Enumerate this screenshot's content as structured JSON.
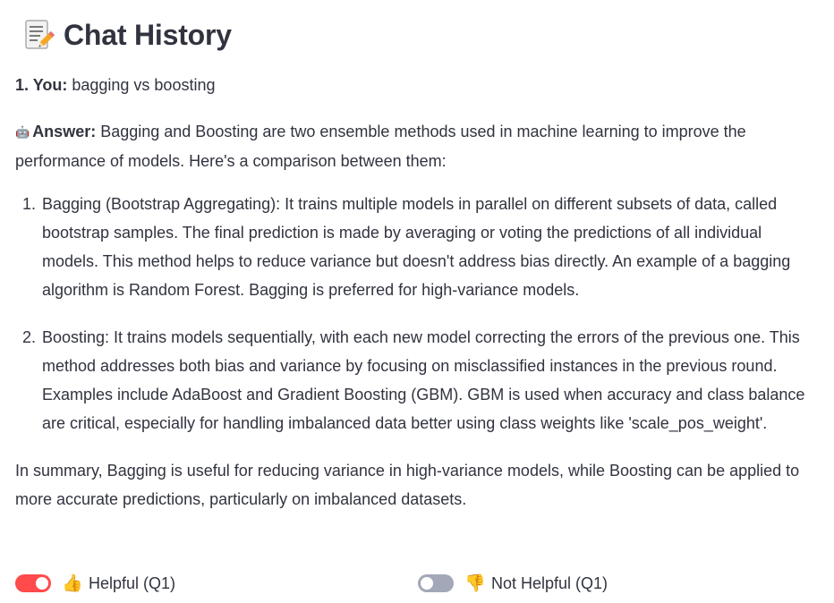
{
  "header": {
    "icon": "memo-icon",
    "title": "Chat History"
  },
  "question": {
    "label": "1. You:",
    "text": "bagging vs boosting"
  },
  "answer": {
    "emoji": "🤖",
    "label": "Answer:",
    "intro": "Bagging and Boosting are two ensemble methods used in machine learning to improve the performance of models. Here's a comparison between them:",
    "points": [
      "Bagging (Bootstrap Aggregating): It trains multiple models in parallel on different subsets of data, called bootstrap samples. The final prediction is made by averaging or voting the predictions of all individual models. This method helps to reduce variance but doesn't address bias directly. An example of a bagging algorithm is Random Forest. Bagging is preferred for high-variance models.",
      "Boosting: It trains models sequentially, with each new model correcting the errors of the previous one. This method addresses both bias and variance by focusing on misclassified instances in the previous round. Examples include AdaBoost and Gradient Boosting (GBM). GBM is used when accuracy and class balance are critical, especially for handling imbalanced data better using class weights like 'scale_pos_weight'."
    ],
    "summary": "In summary, Bagging is useful for reducing variance in high-variance models, while Boosting can be applied to more accurate predictions, particularly on imbalanced datasets."
  },
  "feedback": {
    "helpful": {
      "emoji": "👍",
      "label": "Helpful (Q1)",
      "on": true
    },
    "not_helpful": {
      "emoji": "👎",
      "label": "Not Helpful (Q1)",
      "on": false
    }
  },
  "colors": {
    "text": "#31333f",
    "toggle_on": "#ff4b4b",
    "toggle_off": "#a3a8b8"
  }
}
